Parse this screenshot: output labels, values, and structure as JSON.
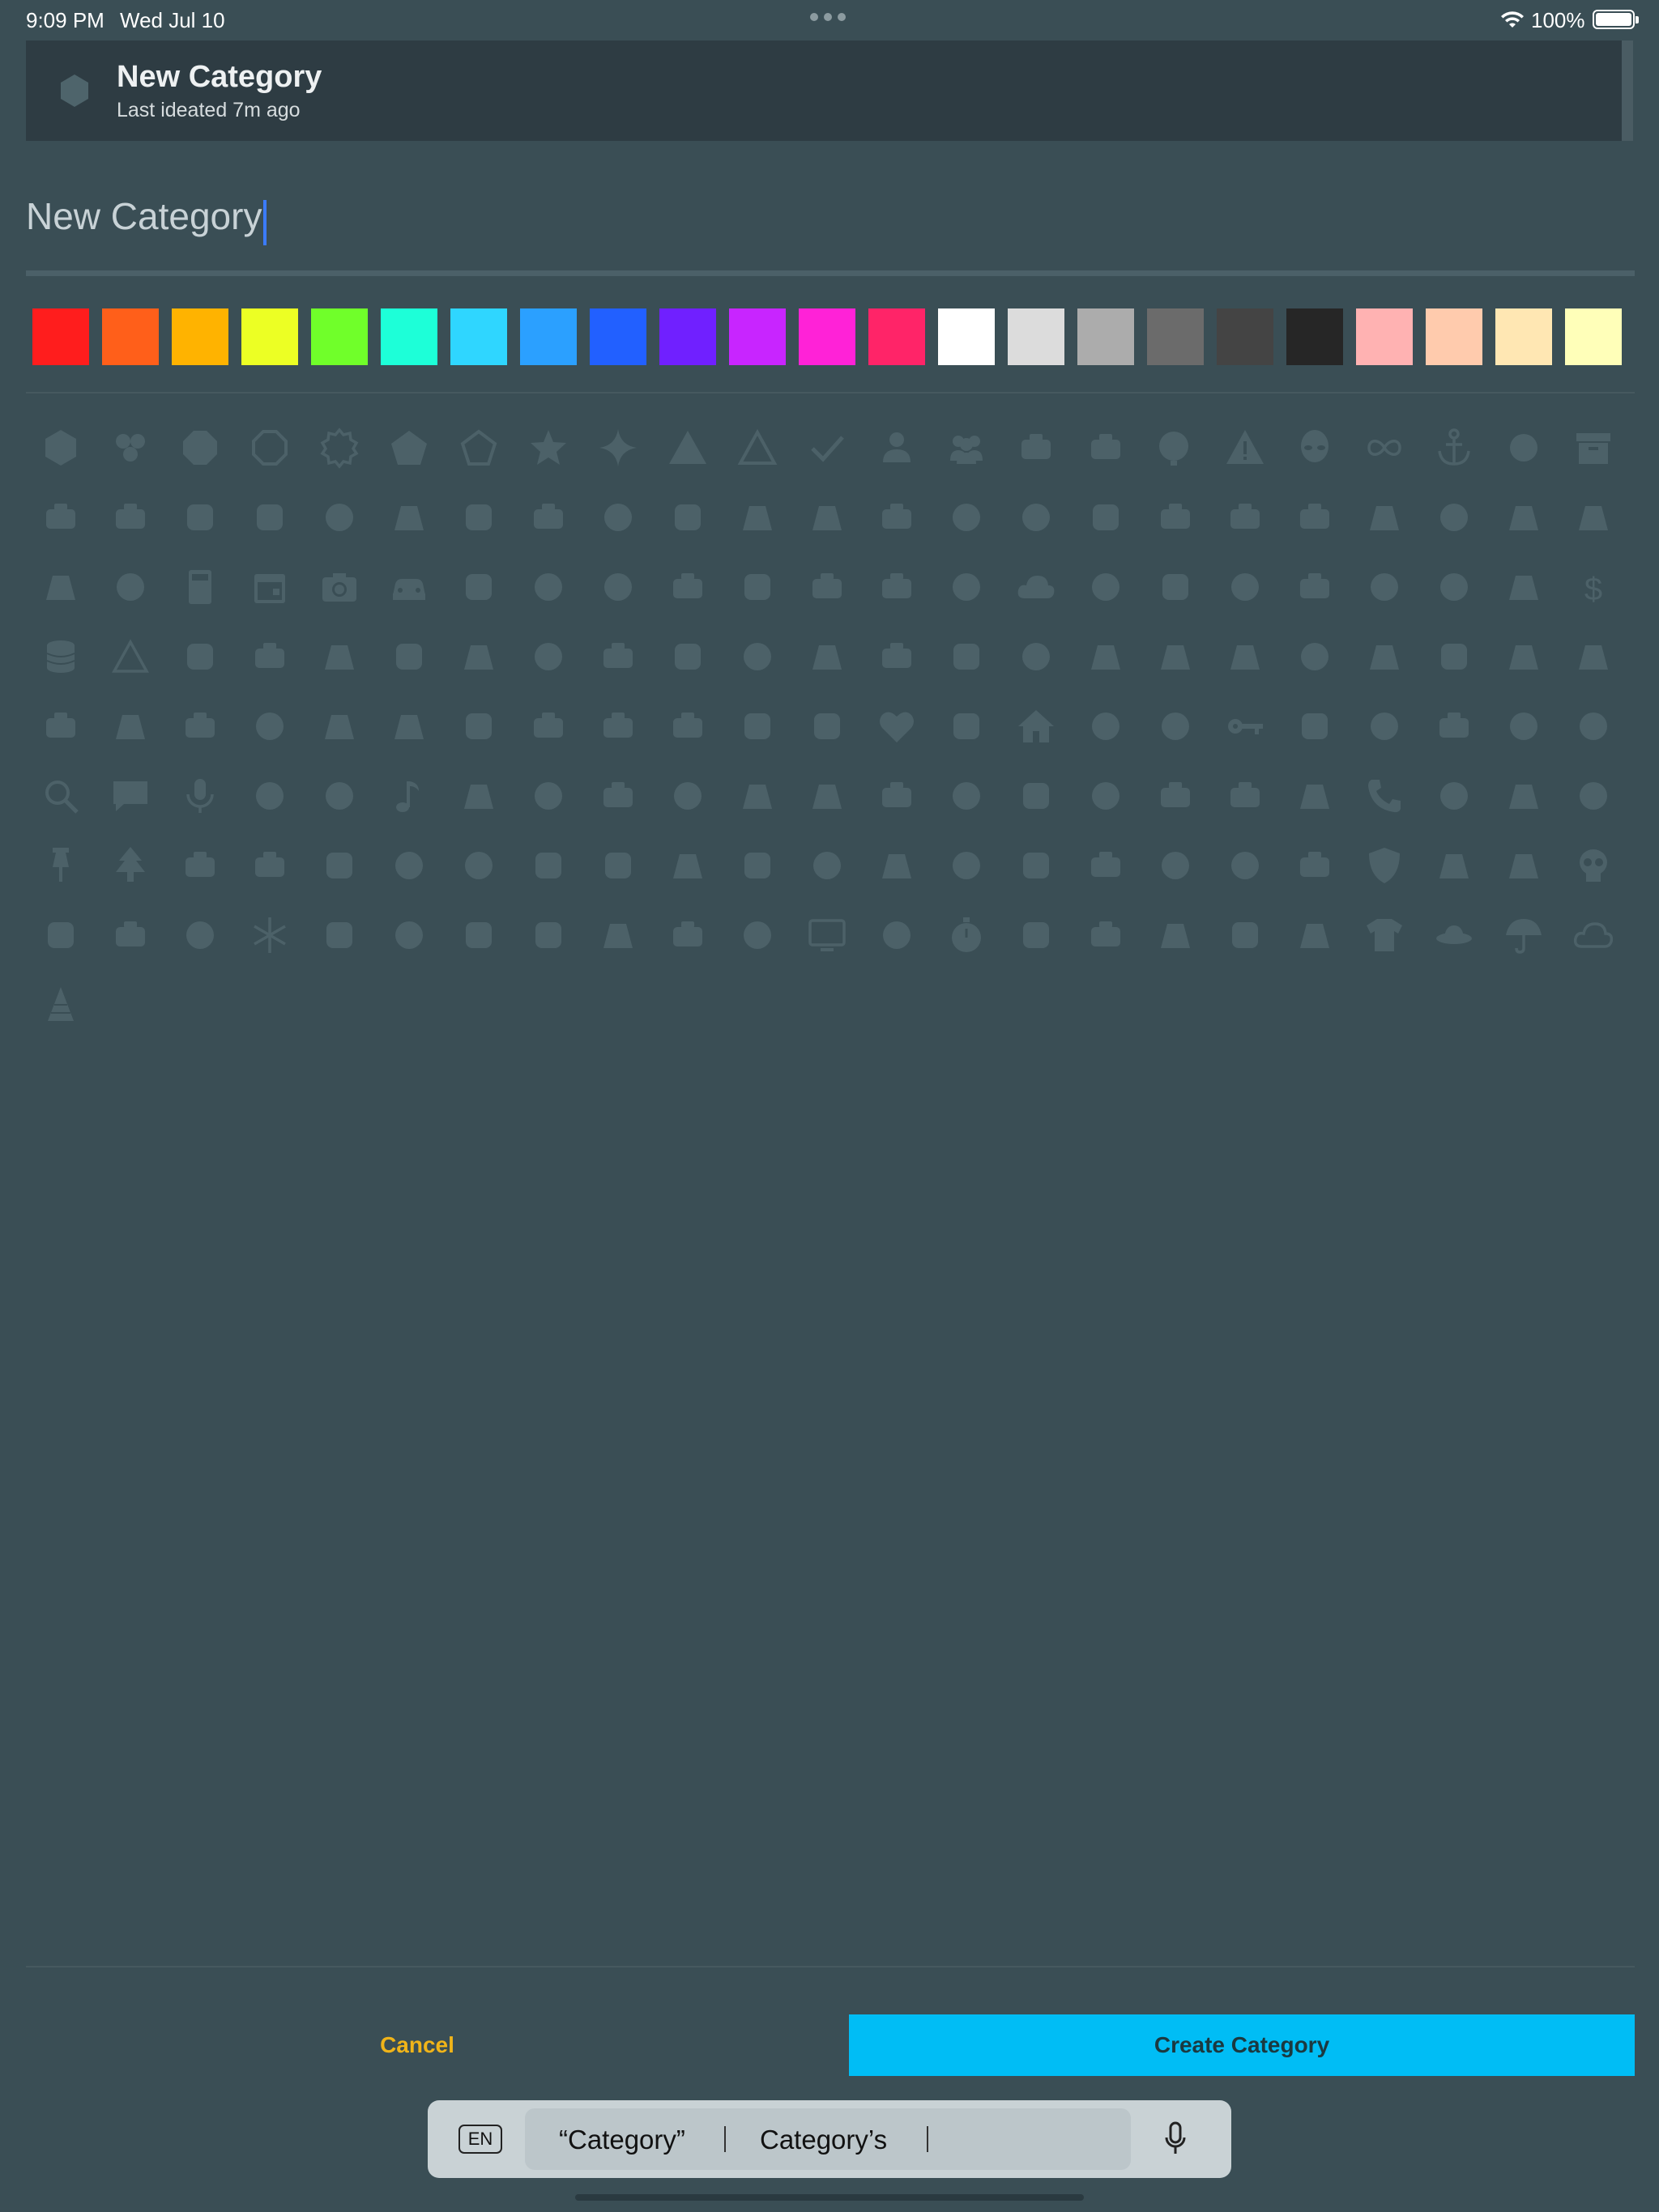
{
  "status_bar": {
    "time": "9:09 PM",
    "date": "Wed Jul 10",
    "battery": "100%"
  },
  "preview": {
    "icon": "hexagon-icon",
    "title": "New Category",
    "subtitle": "Last ideated 7m ago"
  },
  "name_field": {
    "value": "New Category"
  },
  "colors": [
    "#ff1d1d",
    "#ff5f1a",
    "#ffb300",
    "#ecff24",
    "#70ff2a",
    "#1dffd8",
    "#2fd6ff",
    "#2ba0ff",
    "#2260ff",
    "#7020ff",
    "#c825ff",
    "#ff22d7",
    "#ff2468",
    "#ffffff",
    "#dcdcdc",
    "#acacac",
    "#6b6b6b",
    "#444444",
    "#262626",
    "#ffb2b2",
    "#ffcbad",
    "#ffe7b3",
    "#ffffb9"
  ],
  "icons": [
    "hexagon",
    "cluster",
    "octagon",
    "octagon-outline",
    "badge-outline",
    "pentagon",
    "pentagon-outline",
    "star",
    "sparkle",
    "triangle",
    "triangle-outline",
    "check",
    "person",
    "people",
    "hot-air-balloon",
    "airplane",
    "alarm-bell",
    "warning",
    "alien",
    "infinity",
    "anchor",
    "anvil",
    "archive",
    "arm-flex",
    "at-sign",
    "atom",
    "paperclip-h",
    "axe",
    "bath",
    "backpack",
    "baseball",
    "basketball",
    "battery",
    "beaker",
    "bell",
    "bicycle",
    "binoculars",
    "biohazard",
    "bird",
    "book",
    "bow-arrow",
    "tools-hand",
    "brain",
    "gear",
    "brush",
    "bug",
    "bus",
    "cake",
    "calculator",
    "calendar",
    "camera",
    "car",
    "cards",
    "cart",
    "cassette",
    "castle",
    "cat",
    "phone-mobile",
    "chat-bubble",
    "church",
    "cloud",
    "coffee",
    "compass",
    "terminal",
    "gamepad",
    "gift-box",
    "cow",
    "cupcake",
    "dollar",
    "database",
    "delta",
    "desk",
    "dice",
    "dishwasher",
    "dna",
    "dolphin",
    "duck",
    "dumbbell",
    "easter-egg",
    "elephant",
    "engine",
    "smiley",
    "fence",
    "factory",
    "chart",
    "fire",
    "pen-fancy",
    "flag",
    "flash",
    "flower",
    "fridge",
    "paint-roller",
    "gamepad-cross",
    "garage",
    "present",
    "martini",
    "glasses",
    "gondola",
    "golf-cart",
    "grill",
    "hairdryer",
    "hammer",
    "hanger",
    "headphones",
    "heart",
    "hiker",
    "home",
    "ice-cream",
    "kettle",
    "key",
    "knife",
    "eraser",
    "leaf",
    "lightbulb",
    "lightning",
    "magnify",
    "message",
    "microphone",
    "clapperboard",
    "mushroom",
    "music-note",
    "mustache",
    "noodles",
    "notebook",
    "building",
    "skull-robot",
    "owl",
    "palette",
    "panda",
    "paperclip",
    "passport",
    "paw",
    "pencil-box",
    "pencil",
    "phone",
    "piano",
    "pickaxe",
    "piggy-bank",
    "pin",
    "pine-tree",
    "pipe",
    "pirate",
    "pizza",
    "play-pause",
    "presentation",
    "printer",
    "purse",
    "puzzle",
    "radiation",
    "recycle",
    "robot",
    "rocket",
    "roller-skate",
    "service-bell",
    "ruler",
    "graduation-cap",
    "rugby",
    "shield",
    "utensils",
    "skateboard",
    "skull",
    "ice-skate",
    "sleep",
    "slide",
    "snowflake",
    "sofa-lamp",
    "sofa",
    "speaker",
    "store",
    "train",
    "sunglasses",
    "tea",
    "television",
    "magnify-person",
    "stopwatch",
    "wrench-screwdriver",
    "toilet",
    "tooth",
    "school",
    "tow-truck",
    "t-shirt",
    "ufo",
    "umbrella",
    "cloud-outline",
    "party-hat"
  ],
  "actions": {
    "cancel": "Cancel",
    "create": "Create Category"
  },
  "keyboard": {
    "language": "EN",
    "suggestion_1": "“Category”",
    "suggestion_2": "Category’s"
  }
}
